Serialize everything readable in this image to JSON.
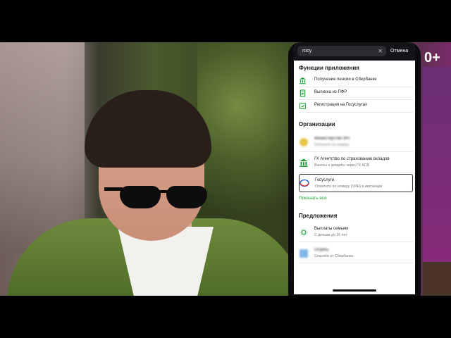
{
  "overlay_badge": "0+",
  "search": {
    "query": "госу",
    "clear_icon": "close-icon",
    "cancel_label": "Отмена"
  },
  "functions": {
    "title": "Функции приложения",
    "items": [
      {
        "label": "Получение пенсии в Сбербанке",
        "icon": "bank-icon"
      },
      {
        "label": "Выписка из ПФР",
        "icon": "document-icon"
      },
      {
        "label": "Регистрация на Госуслугах",
        "icon": "registration-icon"
      }
    ]
  },
  "organizations": {
    "title": "Организации",
    "items": [
      {
        "title": "Министерство МЧ",
        "subtitle": "Оплатите по номеру",
        "icon": "coin-icon",
        "blurred": true
      },
      {
        "title": "ГК Агентство по страхованию вкладов",
        "subtitle": "Взносы и кредиты через ГК АСВ",
        "icon": "bank-icon",
        "blurred": false
      },
      {
        "title": "Госуслуги",
        "subtitle": "Оплатите по номеру (УИН) в квитанции",
        "icon": "gosuslugi-icon",
        "blurred": false
      }
    ],
    "show_all": "Показать все"
  },
  "offers": {
    "title": "Предложения",
    "items": [
      {
        "title": "Выплаты семьям",
        "subtitle": "С детьми до 16 лет",
        "icon": "family-icon",
        "blurred": false
      },
      {
        "title": "Огурец",
        "subtitle": "Спасибо от Сбербанка",
        "icon": "gift-icon",
        "blurred": true
      }
    ]
  },
  "colors": {
    "accent_green": "#21a038",
    "search_bar": "#141317"
  }
}
